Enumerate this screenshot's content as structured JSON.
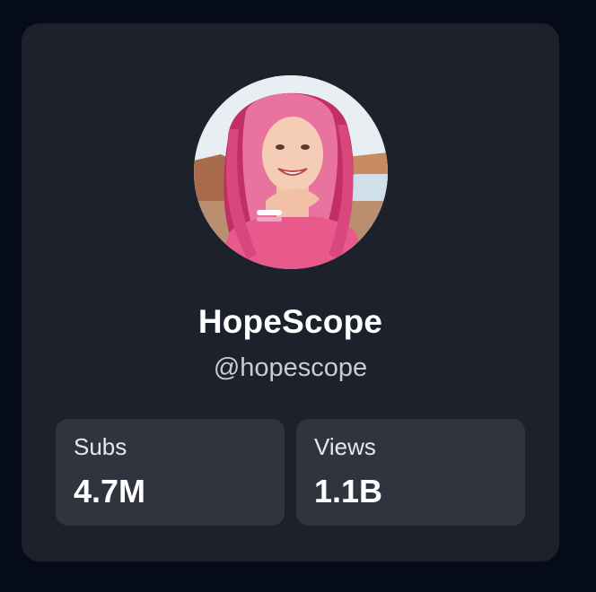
{
  "profile": {
    "name": "HopeScope",
    "handle": "@hopescope",
    "avatar_icon": "profile-photo"
  },
  "stats": [
    {
      "label": "Subs",
      "value": "4.7M"
    },
    {
      "label": "Views",
      "value": "1.1B"
    }
  ],
  "colors": {
    "background": "#050b18",
    "card": "#1c212c",
    "stat_tile": "#2f343f",
    "text_primary": "#ffffff",
    "text_secondary": "#c9ccd3"
  }
}
